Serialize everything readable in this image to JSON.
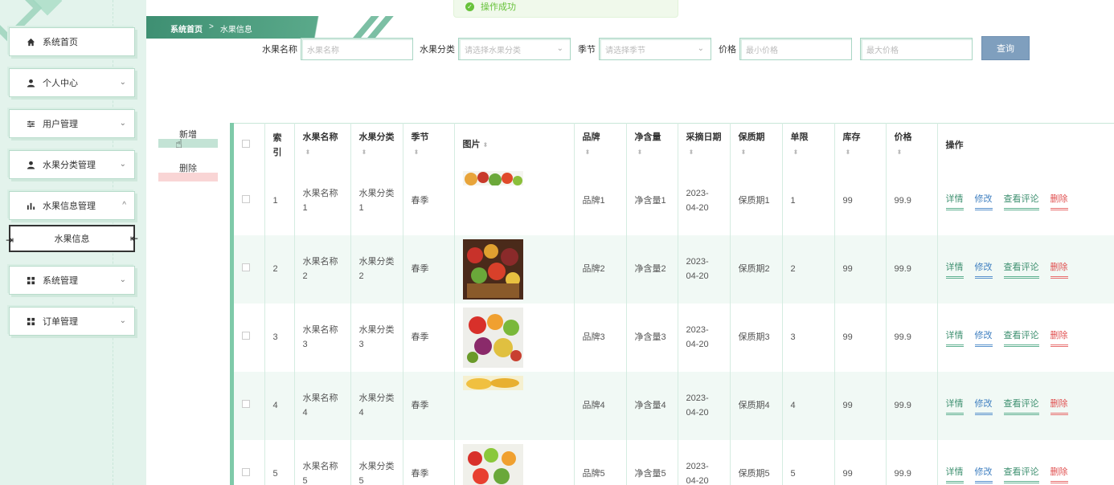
{
  "sidebar": {
    "items": [
      {
        "label": "系统首页",
        "icon": "home-icon",
        "has_chevron": false
      },
      {
        "label": "个人中心",
        "icon": "user-icon",
        "has_chevron": true
      },
      {
        "label": "用户管理",
        "icon": "sliders-icon",
        "has_chevron": true
      },
      {
        "label": "水果分类管理",
        "icon": "user-icon",
        "has_chevron": true
      },
      {
        "label": "水果信息管理",
        "icon": "bar-chart-icon",
        "has_chevron": true,
        "expanded": true
      },
      {
        "label": "系统管理",
        "icon": "grid-icon",
        "has_chevron": true
      },
      {
        "label": "订单管理",
        "icon": "grid-icon",
        "has_chevron": true
      }
    ],
    "submenu_label": "水果信息",
    "chevron_down": "⌄",
    "chevron_up": "^"
  },
  "breadcrumb": {
    "home": "系统首页",
    "separator": ">",
    "current": "水果信息"
  },
  "toast": {
    "message": "操作成功",
    "color": "#67c23a"
  },
  "search": {
    "name_label": "水果名称",
    "name_placeholder": "水果名称",
    "category_label": "水果分类",
    "category_placeholder": "请选择水果分类",
    "season_label": "季节",
    "season_placeholder": "请选择季节",
    "price_label": "价格",
    "min_price_placeholder": "最小价格",
    "max_price_placeholder": "最大价格",
    "query_button": "查询"
  },
  "actions": {
    "add": "新增",
    "delete": "删除"
  },
  "table": {
    "headers": {
      "index": "索引",
      "name": "水果名称",
      "category": "水果分类",
      "season": "季节",
      "image": "图片",
      "brand": "品牌",
      "net": "净含量",
      "date": "采摘日期",
      "shelf": "保质期",
      "limit": "单限",
      "stock": "库存",
      "price": "价格",
      "ops": "操作"
    },
    "ops": {
      "detail": "详情",
      "edit": "修改",
      "review": "查看评论",
      "delete": "删除"
    },
    "rows": [
      {
        "index": "1",
        "name": "水果名称1",
        "category": "水果分类1",
        "season": "春季",
        "brand": "品牌1",
        "net": "净含量1",
        "date": "2023-04-20",
        "shelf": "保质期1",
        "limit": "1",
        "stock": "99",
        "price": "99.9"
      },
      {
        "index": "2",
        "name": "水果名称2",
        "category": "水果分类2",
        "season": "春季",
        "brand": "品牌2",
        "net": "净含量2",
        "date": "2023-04-20",
        "shelf": "保质期2",
        "limit": "2",
        "stock": "99",
        "price": "99.9"
      },
      {
        "index": "3",
        "name": "水果名称3",
        "category": "水果分类3",
        "season": "春季",
        "brand": "品牌3",
        "net": "净含量3",
        "date": "2023-04-20",
        "shelf": "保质期3",
        "limit": "3",
        "stock": "99",
        "price": "99.9"
      },
      {
        "index": "4",
        "name": "水果名称4",
        "category": "水果分类4",
        "season": "春季",
        "brand": "品牌4",
        "net": "净含量4",
        "date": "2023-04-20",
        "shelf": "保质期4",
        "limit": "4",
        "stock": "99",
        "price": "99.9"
      },
      {
        "index": "5",
        "name": "水果名称5",
        "category": "水果分类5",
        "season": "春季",
        "brand": "品牌5",
        "net": "净含量5",
        "date": "2023-04-20",
        "shelf": "保质期5",
        "limit": "5",
        "stock": "99",
        "price": "99.9"
      }
    ]
  },
  "colors": {
    "accent": "#3e8f72",
    "sidebar_bg": "#e3f3ec",
    "query_btn": "#7f9fbe",
    "danger": "#e05050",
    "link": "#3e9070"
  }
}
